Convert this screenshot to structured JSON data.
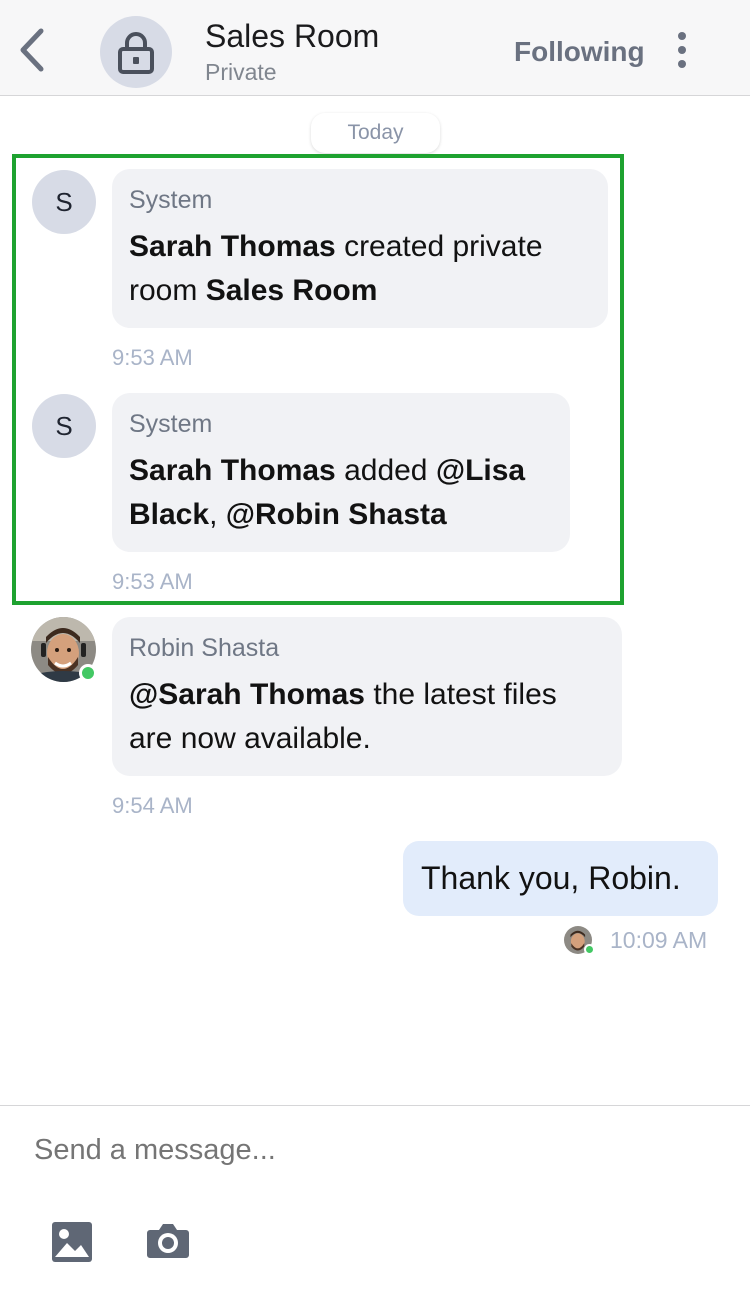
{
  "header": {
    "title": "Sales Room",
    "subtitle": "Private",
    "following_label": "Following"
  },
  "date_separator": "Today",
  "messages": [
    {
      "sender": "System",
      "avatar_letter": "S",
      "name1": "Sarah Thomas",
      "text1": " created private room ",
      "name2": "Sales Room",
      "time": "9:53 AM"
    },
    {
      "sender": "System",
      "avatar_letter": "S",
      "name1": "Sarah Thomas",
      "text1": " added ",
      "mention1": "@Lisa Black",
      "sep": ", ",
      "mention2": "@Robin Shasta",
      "time": "9:53 AM"
    },
    {
      "sender": "Robin Shasta",
      "mention": "@Sarah Thomas",
      "text": " the latest files are now available.",
      "time": "9:54 AM"
    }
  ],
  "outgoing": {
    "text": "Thank you, Robin.",
    "time": "10:09 AM"
  },
  "composer": {
    "placeholder": "Send a message..."
  },
  "colors": {
    "highlight": "#1ea230",
    "online": "#43c864",
    "outgoing_bubble": "#e2ecfb",
    "incoming_bubble": "#f1f2f5"
  }
}
